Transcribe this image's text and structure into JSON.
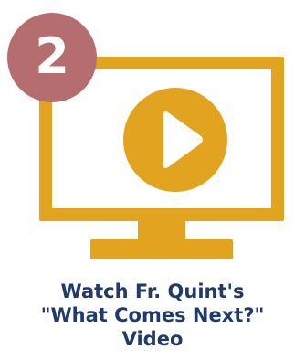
{
  "step": {
    "number": "2"
  },
  "icon": {
    "name": "video-monitor-play-icon",
    "color": "#e2a31f"
  },
  "caption": {
    "line1": "Watch Fr. Quint's",
    "line2": "\"What Comes Next?\"",
    "line3": "Video"
  },
  "colors": {
    "badge": "#b56d70",
    "monitor": "#e2a31f",
    "caption_text": "#1f3a6b",
    "background": "#ffffff"
  }
}
